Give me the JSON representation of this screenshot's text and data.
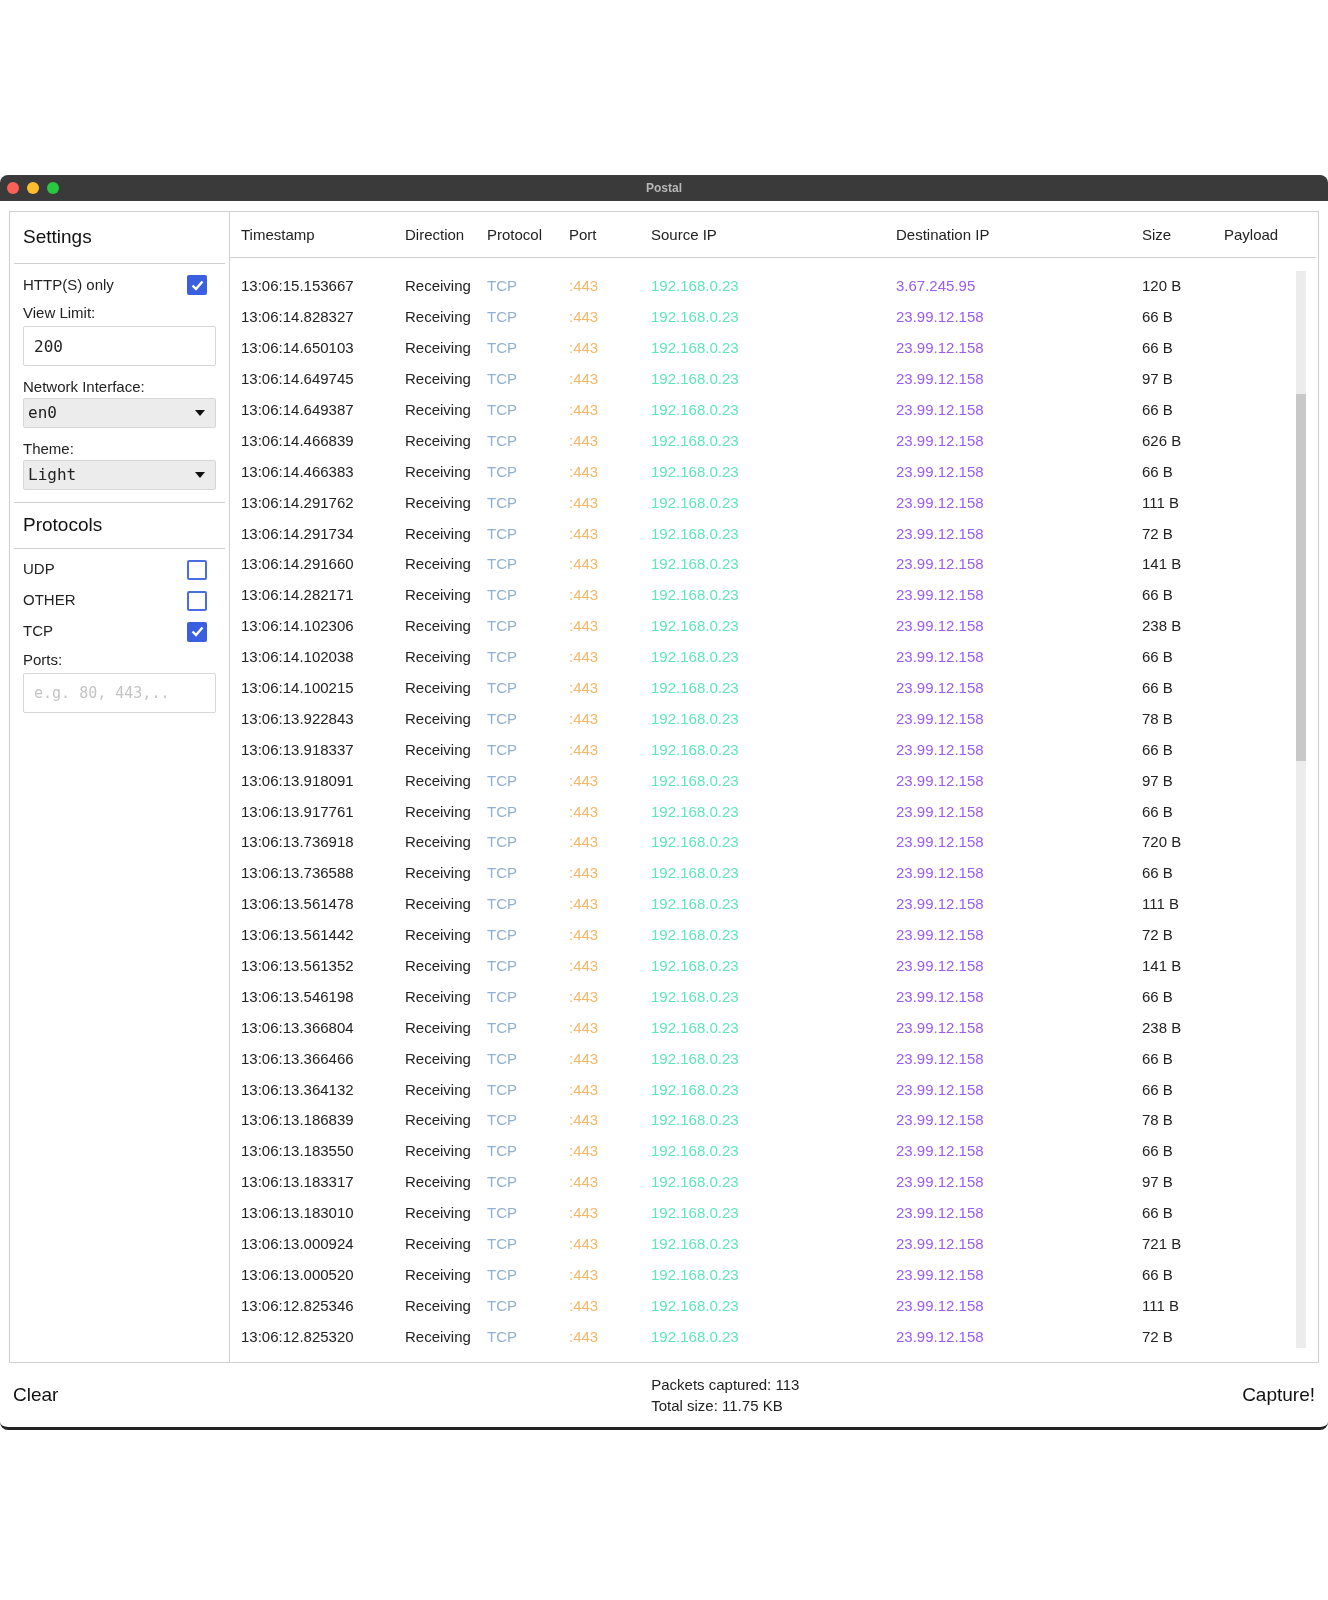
{
  "window": {
    "title": "Postal"
  },
  "sidebar": {
    "settings_title": "Settings",
    "https_only": {
      "label": "HTTP(S) only",
      "checked": true
    },
    "view_limit": {
      "label": "View Limit:",
      "value": "200"
    },
    "network_interface": {
      "label": "Network Interface:",
      "value": "en0"
    },
    "theme": {
      "label": "Theme:",
      "value": "Light"
    },
    "protocols_title": "Protocols",
    "protocols": [
      {
        "label": "UDP",
        "checked": false
      },
      {
        "label": "OTHER",
        "checked": false
      },
      {
        "label": "TCP",
        "checked": true
      }
    ],
    "ports": {
      "label": "Ports:",
      "placeholder": "e.g. 80, 443,.."
    }
  },
  "table": {
    "columns": [
      "Timestamp",
      "Direction",
      "Protocol",
      "Port",
      "Source IP",
      "Destination IP",
      "Size",
      "Payload"
    ],
    "rows": [
      [
        "13:06:15.153667",
        "Receiving",
        "TCP",
        ":443",
        "192.168.0.23",
        "3.67.245.95",
        "120 B"
      ],
      [
        "13:06:14.828327",
        "Receiving",
        "TCP",
        ":443",
        "192.168.0.23",
        "23.99.12.158",
        "66 B"
      ],
      [
        "13:06:14.650103",
        "Receiving",
        "TCP",
        ":443",
        "192.168.0.23",
        "23.99.12.158",
        "66 B"
      ],
      [
        "13:06:14.649745",
        "Receiving",
        "TCP",
        ":443",
        "192.168.0.23",
        "23.99.12.158",
        "97 B"
      ],
      [
        "13:06:14.649387",
        "Receiving",
        "TCP",
        ":443",
        "192.168.0.23",
        "23.99.12.158",
        "66 B"
      ],
      [
        "13:06:14.466839",
        "Receiving",
        "TCP",
        ":443",
        "192.168.0.23",
        "23.99.12.158",
        "626 B"
      ],
      [
        "13:06:14.466383",
        "Receiving",
        "TCP",
        ":443",
        "192.168.0.23",
        "23.99.12.158",
        "66 B"
      ],
      [
        "13:06:14.291762",
        "Receiving",
        "TCP",
        ":443",
        "192.168.0.23",
        "23.99.12.158",
        "111 B"
      ],
      [
        "13:06:14.291734",
        "Receiving",
        "TCP",
        ":443",
        "192.168.0.23",
        "23.99.12.158",
        "72 B"
      ],
      [
        "13:06:14.291660",
        "Receiving",
        "TCP",
        ":443",
        "192.168.0.23",
        "23.99.12.158",
        "141 B"
      ],
      [
        "13:06:14.282171",
        "Receiving",
        "TCP",
        ":443",
        "192.168.0.23",
        "23.99.12.158",
        "66 B"
      ],
      [
        "13:06:14.102306",
        "Receiving",
        "TCP",
        ":443",
        "192.168.0.23",
        "23.99.12.158",
        "238 B"
      ],
      [
        "13:06:14.102038",
        "Receiving",
        "TCP",
        ":443",
        "192.168.0.23",
        "23.99.12.158",
        "66 B"
      ],
      [
        "13:06:14.100215",
        "Receiving",
        "TCP",
        ":443",
        "192.168.0.23",
        "23.99.12.158",
        "66 B"
      ],
      [
        "13:06:13.922843",
        "Receiving",
        "TCP",
        ":443",
        "192.168.0.23",
        "23.99.12.158",
        "78 B"
      ],
      [
        "13:06:13.918337",
        "Receiving",
        "TCP",
        ":443",
        "192.168.0.23",
        "23.99.12.158",
        "66 B"
      ],
      [
        "13:06:13.918091",
        "Receiving",
        "TCP",
        ":443",
        "192.168.0.23",
        "23.99.12.158",
        "97 B"
      ],
      [
        "13:06:13.917761",
        "Receiving",
        "TCP",
        ":443",
        "192.168.0.23",
        "23.99.12.158",
        "66 B"
      ],
      [
        "13:06:13.736918",
        "Receiving",
        "TCP",
        ":443",
        "192.168.0.23",
        "23.99.12.158",
        "720 B"
      ],
      [
        "13:06:13.736588",
        "Receiving",
        "TCP",
        ":443",
        "192.168.0.23",
        "23.99.12.158",
        "66 B"
      ],
      [
        "13:06:13.561478",
        "Receiving",
        "TCP",
        ":443",
        "192.168.0.23",
        "23.99.12.158",
        "111 B"
      ],
      [
        "13:06:13.561442",
        "Receiving",
        "TCP",
        ":443",
        "192.168.0.23",
        "23.99.12.158",
        "72 B"
      ],
      [
        "13:06:13.561352",
        "Receiving",
        "TCP",
        ":443",
        "192.168.0.23",
        "23.99.12.158",
        "141 B"
      ],
      [
        "13:06:13.546198",
        "Receiving",
        "TCP",
        ":443",
        "192.168.0.23",
        "23.99.12.158",
        "66 B"
      ],
      [
        "13:06:13.366804",
        "Receiving",
        "TCP",
        ":443",
        "192.168.0.23",
        "23.99.12.158",
        "238 B"
      ],
      [
        "13:06:13.366466",
        "Receiving",
        "TCP",
        ":443",
        "192.168.0.23",
        "23.99.12.158",
        "66 B"
      ],
      [
        "13:06:13.364132",
        "Receiving",
        "TCP",
        ":443",
        "192.168.0.23",
        "23.99.12.158",
        "66 B"
      ],
      [
        "13:06:13.186839",
        "Receiving",
        "TCP",
        ":443",
        "192.168.0.23",
        "23.99.12.158",
        "78 B"
      ],
      [
        "13:06:13.183550",
        "Receiving",
        "TCP",
        ":443",
        "192.168.0.23",
        "23.99.12.158",
        "66 B"
      ],
      [
        "13:06:13.183317",
        "Receiving",
        "TCP",
        ":443",
        "192.168.0.23",
        "23.99.12.158",
        "97 B"
      ],
      [
        "13:06:13.183010",
        "Receiving",
        "TCP",
        ":443",
        "192.168.0.23",
        "23.99.12.158",
        "66 B"
      ],
      [
        "13:06:13.000924",
        "Receiving",
        "TCP",
        ":443",
        "192.168.0.23",
        "23.99.12.158",
        "721 B"
      ],
      [
        "13:06:13.000520",
        "Receiving",
        "TCP",
        ":443",
        "192.168.0.23",
        "23.99.12.158",
        "66 B"
      ],
      [
        "13:06:12.825346",
        "Receiving",
        "TCP",
        ":443",
        "192.168.0.23",
        "23.99.12.158",
        "111 B"
      ],
      [
        "13:06:12.825320",
        "Receiving",
        "TCP",
        ":443",
        "192.168.0.23",
        "23.99.12.158",
        "72 B"
      ]
    ]
  },
  "footer": {
    "clear_button": "Clear",
    "packets_captured": "Packets captured: 113",
    "total_size": "Total size: 11.75 KB",
    "capture_button": "Capture!"
  }
}
